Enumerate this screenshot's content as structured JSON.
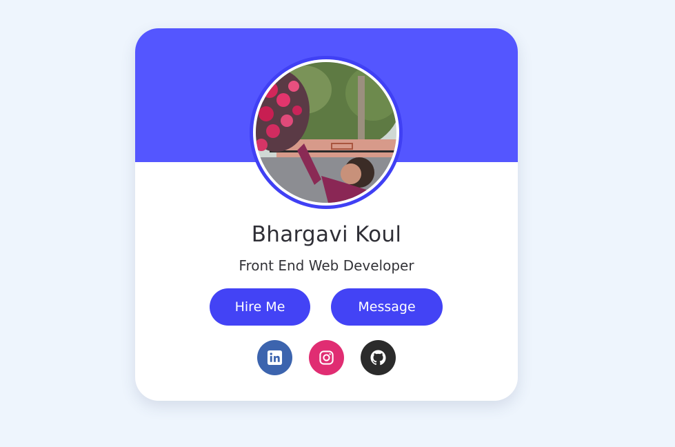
{
  "profile": {
    "name": "Bhargavi Koul",
    "role": "Front End Web Developer"
  },
  "actions": {
    "hire_label": "Hire Me",
    "message_label": "Message"
  },
  "social": [
    {
      "icon": "linkedin-icon",
      "color": "#3c64ae"
    },
    {
      "icon": "instagram-icon",
      "color": "#e02d72"
    },
    {
      "icon": "github-icon",
      "color": "#2b2b2b"
    }
  ],
  "colors": {
    "banner": "#5456ff",
    "accent": "#4343f5",
    "page_background": "#eef5fd"
  }
}
